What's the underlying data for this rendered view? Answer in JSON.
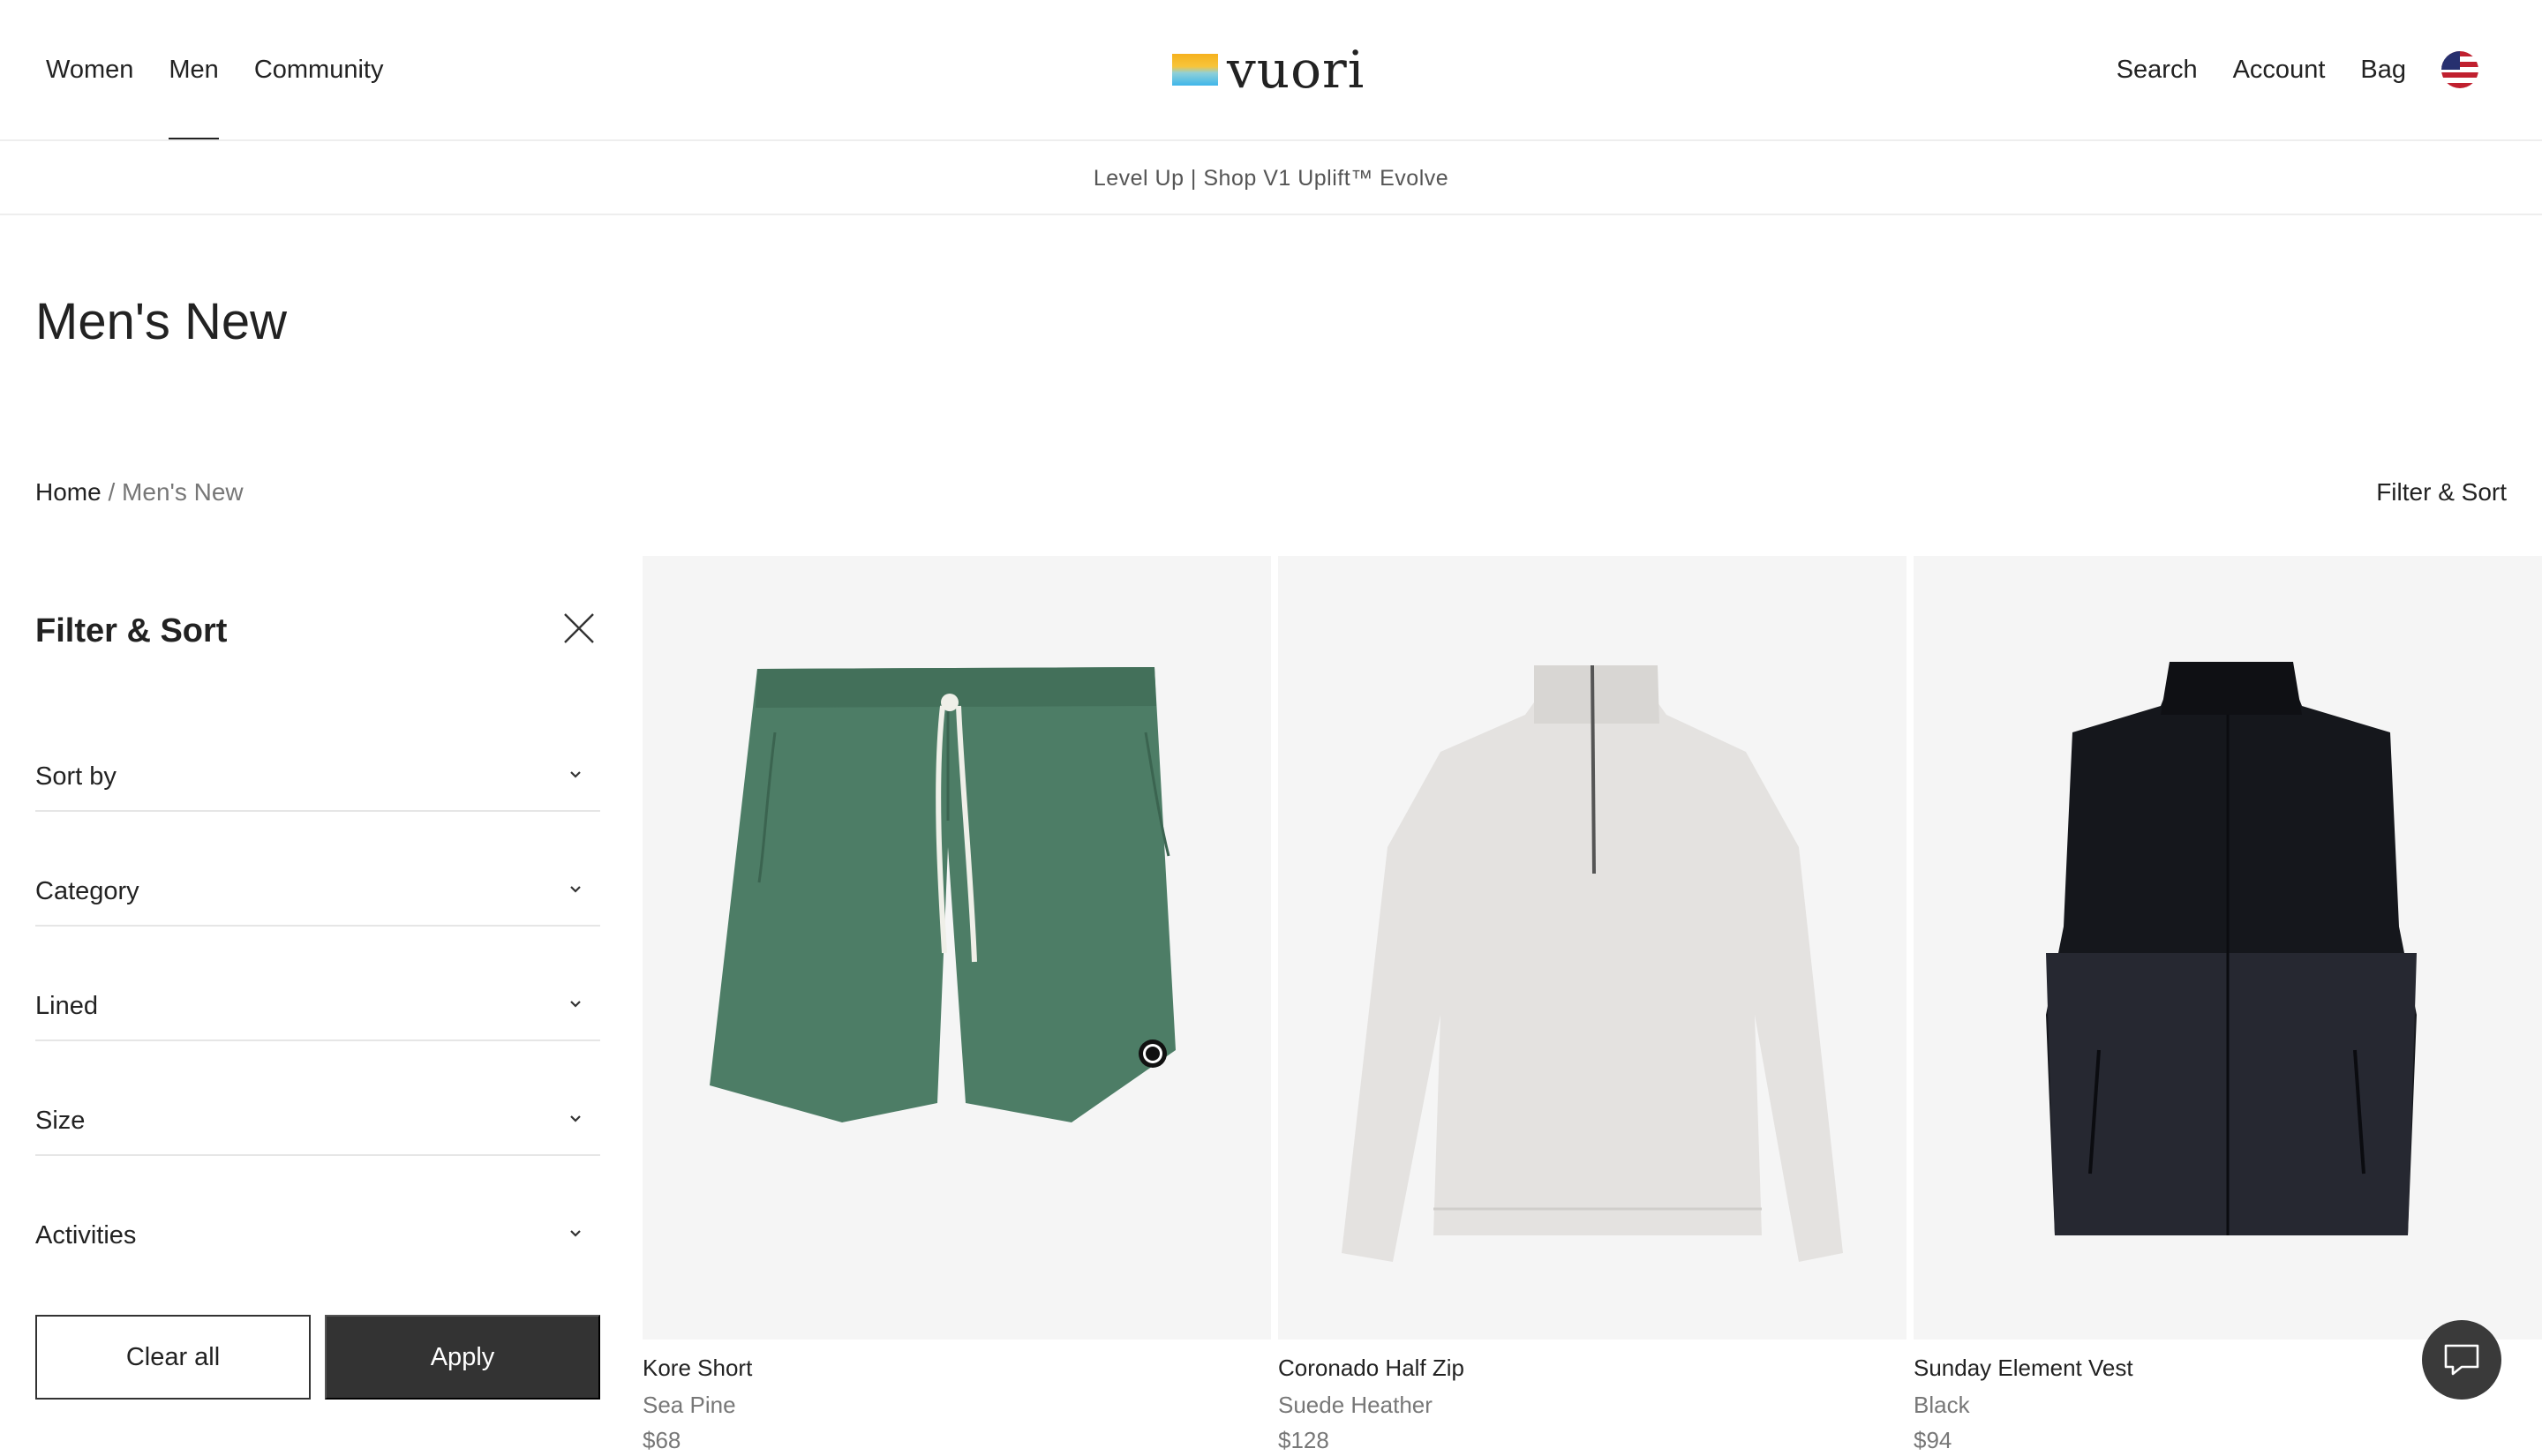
{
  "header": {
    "nav_left": [
      "Women",
      "Men",
      "Community"
    ],
    "active_nav": "Men",
    "logo_text": "vuori",
    "nav_right": {
      "search": "Search",
      "account": "Account",
      "bag": "Bag"
    },
    "locale_icon": "us-flag-icon"
  },
  "promo": {
    "text": "Level Up | Shop V1 Uplift™ Evolve"
  },
  "page": {
    "title": "Men's New"
  },
  "breadcrumb": {
    "home": "Home",
    "separator": "/",
    "current": "Men's New"
  },
  "toolbar": {
    "filter_sort_label": "Filter & Sort"
  },
  "filter_panel": {
    "title": "Filter & Sort",
    "groups": [
      "Sort by",
      "Category",
      "Lined",
      "Size",
      "Activities"
    ],
    "clear_label": "Clear all",
    "apply_label": "Apply"
  },
  "products": [
    {
      "name": "Kore Short",
      "color": "Sea Pine",
      "price": "$68",
      "swatch": "#4d7d66"
    },
    {
      "name": "Coronado Half Zip",
      "color": "Suede Heather",
      "price": "$128",
      "swatch": "#e4e2e0"
    },
    {
      "name": "Sunday Element Vest",
      "color": "Black",
      "price": "$94",
      "swatch": "#15171c"
    }
  ],
  "colors": {
    "primary_button": "#333333",
    "text": "#222222",
    "muted_text": "#777777",
    "image_bg": "#f5f5f5"
  }
}
